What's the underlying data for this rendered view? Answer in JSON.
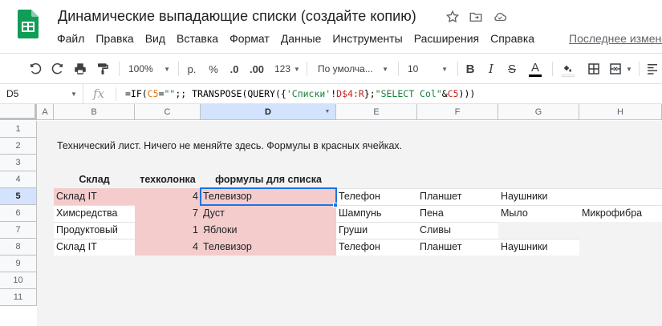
{
  "doc": {
    "title": "Динамические выпадающие списки (создайте копию)",
    "last_edit": "Последнее изменение"
  },
  "menu": [
    "Файл",
    "Правка",
    "Вид",
    "Вставка",
    "Формат",
    "Данные",
    "Инструменты",
    "Расширения",
    "Справка"
  ],
  "toolbar": {
    "zoom": "100%",
    "currency": "р.",
    "percent": "%",
    "dec_less": ".0",
    "dec_more": ".00",
    "num_format": "123",
    "font": "По умолча...",
    "font_size": "10",
    "bold": "B",
    "italic": "I",
    "strike": "S",
    "text_color": "A"
  },
  "formula_bar": {
    "cell": "D5",
    "fx": "fx",
    "p1": "=IF(",
    "ref1": "C5",
    "p2": "=",
    "str1": "\"\"",
    "p3": ";; TRANSPOSE(QUERY({",
    "str2": "'Списки'",
    "p4": "!",
    "ref2": "D$4:R",
    "p5": "};",
    "str3": "\"SELECT Col\"",
    "p6": "&",
    "ref3": "C5",
    "p7": ")))"
  },
  "columns": [
    "A",
    "B",
    "C",
    "D",
    "E",
    "F",
    "G",
    "H"
  ],
  "rows": [
    "1",
    "2",
    "3",
    "4",
    "5",
    "6",
    "7",
    "8",
    "9",
    "10",
    "11"
  ],
  "sheet": {
    "note": "Технический лист. Ничего не меняйте здесь. Формулы в красных ячейках.",
    "headers": [
      "Склад",
      "техколонка",
      "формулы для списка"
    ],
    "data": [
      [
        "Склад IT",
        "4",
        "Телевизор",
        "Телефон",
        "Планшет",
        "Наушники",
        ""
      ],
      [
        "Химсредства",
        "7",
        "Дуст",
        "Шампунь",
        "Пена",
        "Мыло",
        "Микрофибра"
      ],
      [
        "Продуктовый",
        "1",
        "Яблоки",
        "Груши",
        "Сливы",
        "",
        ""
      ],
      [
        "Склад IT",
        "4",
        "Телевизор",
        "Телефон",
        "Планшет",
        "Наушники",
        ""
      ]
    ]
  },
  "colors": {
    "pink": "#f4cccc",
    "selection": "#1a73e8",
    "sheets_green": "#0f9d58"
  }
}
